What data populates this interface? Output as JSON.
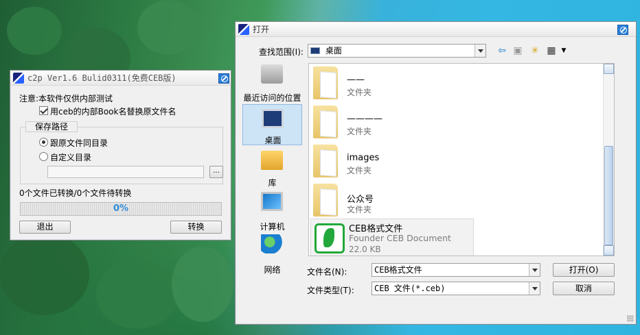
{
  "c2p": {
    "title": "c2p   Ver1.6 Bulid0311(免费CEB版)",
    "notice": "注意:本软件仅供内部测试",
    "use_book_name_label": "用ceb的内部Book名替换原文件名",
    "use_book_name_checked": true,
    "save_path_group": "保存路径",
    "radio_same_dir": "跟原文件同目录",
    "radio_custom_dir": "自定义目录",
    "custom_dir_value": "",
    "browse_label": "...",
    "status": "0个文件已转换/0个文件待转换",
    "progress_percent": 0,
    "progress_text": "0%",
    "exit_label": "退出",
    "convert_label": "转换"
  },
  "open_dialog": {
    "title": "打开",
    "look_in_label": "查找范围(I):",
    "look_in_value": "桌面",
    "places": [
      {
        "label": "最近访问的位置"
      },
      {
        "label": "桌面"
      },
      {
        "label": "库"
      },
      {
        "label": "计算机"
      },
      {
        "label": "网络"
      }
    ],
    "files": [
      {
        "name": "——",
        "type": "文件夹"
      },
      {
        "name": "————",
        "type": "文件夹"
      },
      {
        "name": "images",
        "type": "文件夹"
      },
      {
        "name": "公众号",
        "type": "文件夹"
      },
      {
        "name": "CEB格式文件",
        "type": "Founder CEB Document",
        "size": "22.0 KB"
      }
    ],
    "filename_label": "文件名(N):",
    "filename_value": "CEB格式文件",
    "filetype_label": "文件类型(T):",
    "filetype_value": "CEB 文件(*.ceb)",
    "open_label": "打开(O)",
    "cancel_label": "取消"
  },
  "colors": {
    "accent": "#2a7ed8",
    "progress_text": "#2f8bd8",
    "ceb_green": "#22a83a"
  }
}
